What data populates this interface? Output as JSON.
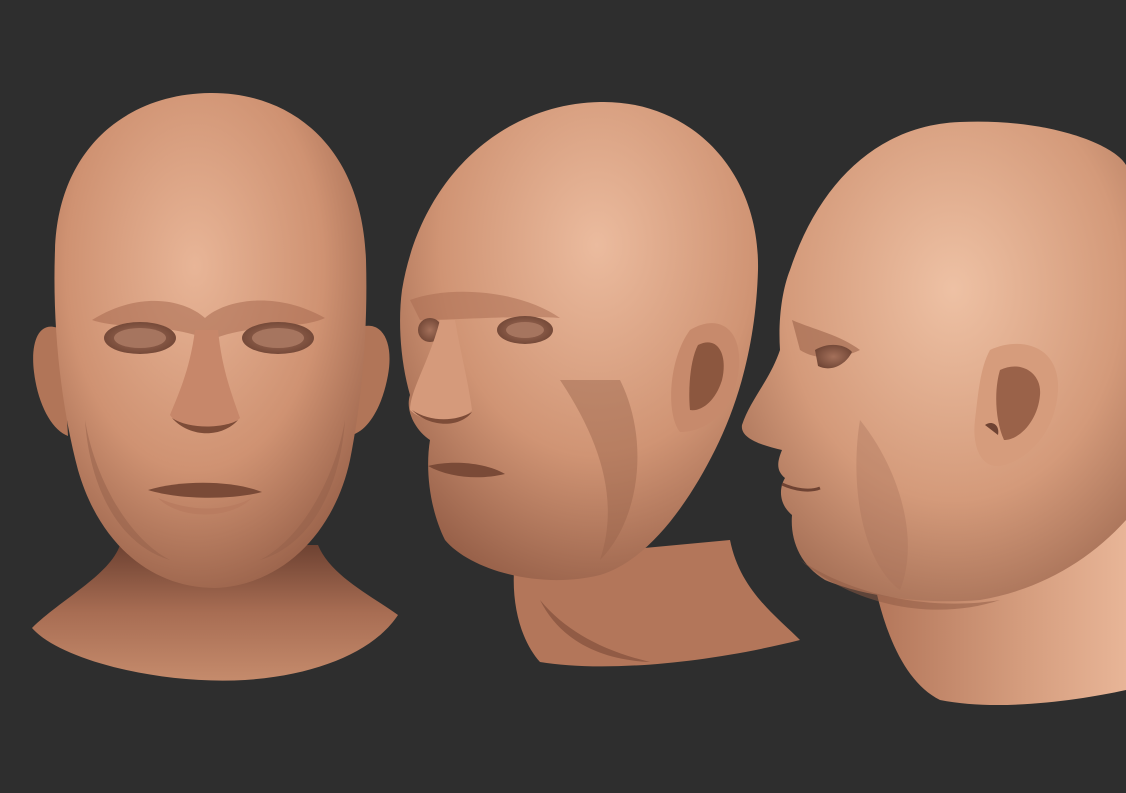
{
  "scene": {
    "background_color": "#2e2e2e",
    "skin_base": "#c98a6a",
    "skin_light": "#e7b495",
    "skin_shadow": "#8e5a43",
    "skin_deep": "#6f4333",
    "heads": [
      {
        "id": "front",
        "view": "front"
      },
      {
        "id": "three-quarter",
        "view": "three-quarter"
      },
      {
        "id": "profile",
        "view": "profile"
      }
    ]
  }
}
